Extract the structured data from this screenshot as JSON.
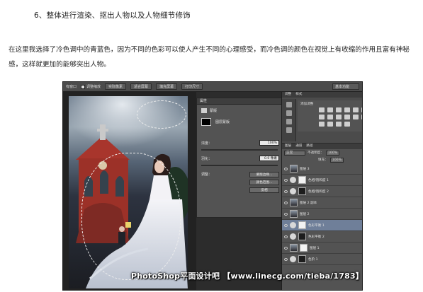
{
  "heading": "6、整体进行渲染、抠出人物以及人物细节修饰",
  "paragraph": "在这里我选择了冷色调中的青蓝色，因为不同的色彩可以使人产生不同的心理感受，而冷色调的颜色在视觉上有收缩的作用且富有神秘感，这样就更加的能够突出人物。",
  "screenshot": {
    "optionbar": {
      "item1": "有窗口",
      "checkbox_label": "调整缩放",
      "btn1": "实际像素",
      "btn2": "适合屏幕",
      "btn3": "填充屏幕",
      "btn4": "打印尺寸",
      "workspace": "基本功能"
    },
    "properties": {
      "tab": "属性",
      "type": "蒙版",
      "layer_mask": "图层蒙版",
      "density_label": "浓度：",
      "density_value": "100%",
      "feather_label": "羽化：",
      "feather_value": "0.0 像素",
      "refine_label": "调整：",
      "btn_edge": "蒙版边缘...",
      "btn_range": "颜色范围...",
      "btn_invert": "反相"
    },
    "right_panel": {
      "tab1": "调整",
      "tab2": "样式",
      "add_adjustment": "添加调整"
    },
    "layers": {
      "tabs": [
        "图层",
        "通道",
        "路径"
      ],
      "blend_mode": "正常",
      "opacity_label": "不透明度：",
      "opacity_value": "100%",
      "fill_label": "填充：",
      "fill_value": "100%",
      "rows": [
        {
          "name": "图层 3",
          "thumb": "photo",
          "mask": false
        },
        {
          "name": "色相/饱和度 1",
          "thumb": "adjust",
          "mask": true
        },
        {
          "name": "色相/饱和度 2",
          "thumb": "adjust",
          "mask": true
        },
        {
          "name": "图层 2 副本",
          "thumb": "photo",
          "mask": false
        },
        {
          "name": "图层 2",
          "thumb": "photo",
          "mask": false
        },
        {
          "name": "色彩平衡 1",
          "thumb": "adjust",
          "mask": true,
          "selected": true
        },
        {
          "name": "色彩平衡 2",
          "thumb": "adjust",
          "mask": true
        },
        {
          "name": "图层 1",
          "thumb": "photo",
          "mask": true
        },
        {
          "name": "色阶 1",
          "thumb": "adjust",
          "mask": true
        }
      ]
    }
  },
  "watermark": "PhotoShop平面设计吧 【www.linecg.com/tieba/1783】",
  "colors": {
    "selected_layer": "#6f7f99",
    "ps_dark": "#3a3a3a",
    "panel": "#535353"
  }
}
